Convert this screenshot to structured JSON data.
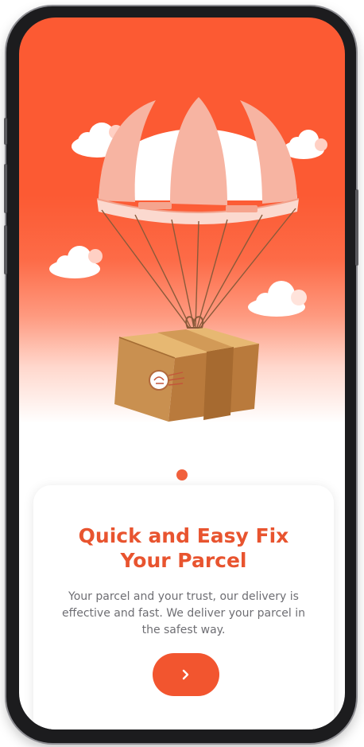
{
  "onboarding": {
    "title": "Quick and Easy Fix Your Parcel",
    "description": "Your parcel and your trust, our delivery is effective and fast. We deliver your parcel in the safest way.",
    "pager_current": 1,
    "pager_total": 1,
    "next_icon": "chevron-right-icon"
  },
  "colors": {
    "brand": "#f2552f",
    "title": "#e8542f",
    "text": "#6e6e73",
    "card": "#ffffff"
  }
}
